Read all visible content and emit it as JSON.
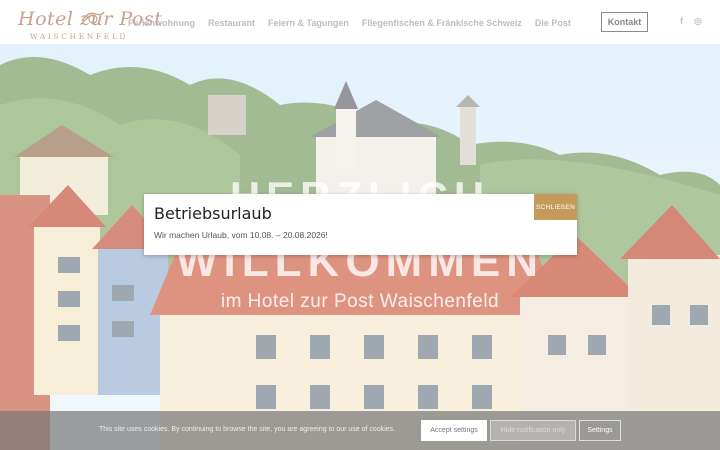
{
  "header": {
    "logo_script": "Hotel zur Post",
    "logo_sub": "WAISCHENFELD",
    "nav": [
      "Ferienwohnung",
      "Restaurant",
      "Feiern & Tagungen",
      "Fliegenfischen & Fränkische Schweiz",
      "Die Post"
    ],
    "contact_label": "Kontakt",
    "social_icons": [
      "facebook-icon",
      "instagram-icon"
    ],
    "facebook_glyph": "f",
    "instagram_glyph": "◎"
  },
  "hero": {
    "title_line1": "HERZLICH",
    "title_line2": "WILLKOMMEN",
    "subtitle": "im Hotel zur Post Waischenfeld"
  },
  "popup": {
    "title": "Betriebsurlaub",
    "text": "Wir machen Urlaub, vom 10.08. – 20.08.2026!",
    "close_label": "SCHLIEßEN"
  },
  "cookie": {
    "text": "This site uses cookies. By continuing to browse the site, you are agreeing to our use of cookies.",
    "accept_label": "Accept settings",
    "hide_label": "Hide notification only",
    "settings_label": "Settings"
  },
  "colors": {
    "accent": "#c59a5b",
    "logo": "#c9a08c"
  }
}
